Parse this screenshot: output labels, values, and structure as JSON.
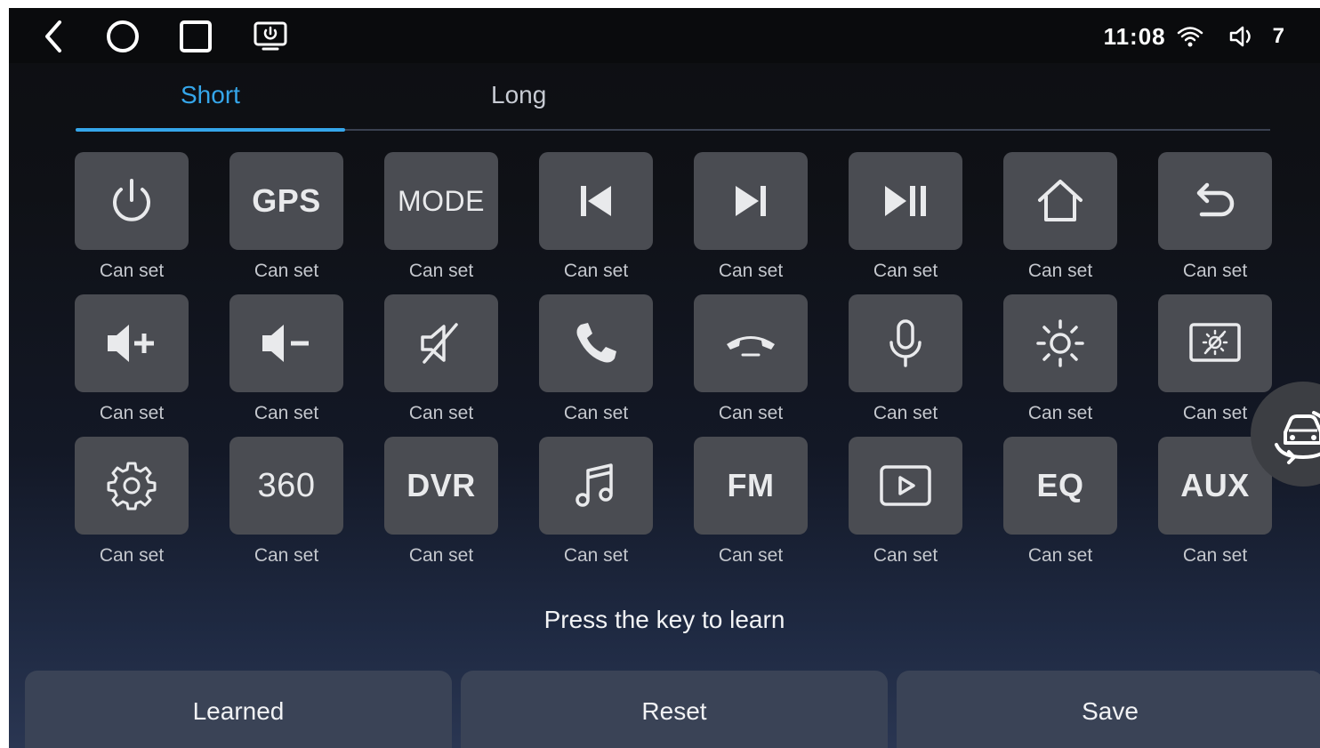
{
  "status": {
    "time": "11:08",
    "volume": "7"
  },
  "tabs": [
    {
      "label": "Short",
      "active": true
    },
    {
      "label": "Long",
      "active": false
    }
  ],
  "keys": [
    [
      {
        "icon": "power-icon",
        "text": "",
        "label": "Can set"
      },
      {
        "icon": "",
        "text": "GPS",
        "label": "Can set"
      },
      {
        "icon": "",
        "text": "MODE",
        "label": "Can set"
      },
      {
        "icon": "skip-previous-icon",
        "text": "",
        "label": "Can set"
      },
      {
        "icon": "skip-next-icon",
        "text": "",
        "label": "Can set"
      },
      {
        "icon": "play-pause-icon",
        "text": "",
        "label": "Can set"
      },
      {
        "icon": "home-icon",
        "text": "",
        "label": "Can set"
      },
      {
        "icon": "back-arrow-icon",
        "text": "",
        "label": "Can set"
      }
    ],
    [
      {
        "icon": "volume-up-icon",
        "text": "",
        "label": "Can set"
      },
      {
        "icon": "volume-down-icon",
        "text": "",
        "label": "Can set"
      },
      {
        "icon": "mute-icon",
        "text": "",
        "label": "Can set"
      },
      {
        "icon": "phone-answer-icon",
        "text": "",
        "label": "Can set"
      },
      {
        "icon": "phone-hangup-icon",
        "text": "",
        "label": "Can set"
      },
      {
        "icon": "microphone-icon",
        "text": "",
        "label": "Can set"
      },
      {
        "icon": "brightness-icon",
        "text": "",
        "label": "Can set"
      },
      {
        "icon": "screen-off-icon",
        "text": "",
        "label": "Can set"
      }
    ],
    [
      {
        "icon": "settings-gear-icon",
        "text": "",
        "label": "Can set"
      },
      {
        "icon": "",
        "text": "360",
        "label": "Can set"
      },
      {
        "icon": "",
        "text": "DVR",
        "label": "Can set"
      },
      {
        "icon": "music-note-icon",
        "text": "",
        "label": "Can set"
      },
      {
        "icon": "",
        "text": "FM",
        "label": "Can set"
      },
      {
        "icon": "video-play-icon",
        "text": "",
        "label": "Can set"
      },
      {
        "icon": "",
        "text": "EQ",
        "label": "Can set"
      },
      {
        "icon": "",
        "text": "AUX",
        "label": "Can set"
      }
    ]
  ],
  "hint": "Press the key to learn",
  "buttons": {
    "learned": "Learned",
    "reset": "Reset",
    "save": "Save"
  },
  "colors": {
    "accent": "#35a6ea",
    "key_bg": "#4a4c52",
    "bottom_button_bg": "#3a4356"
  }
}
